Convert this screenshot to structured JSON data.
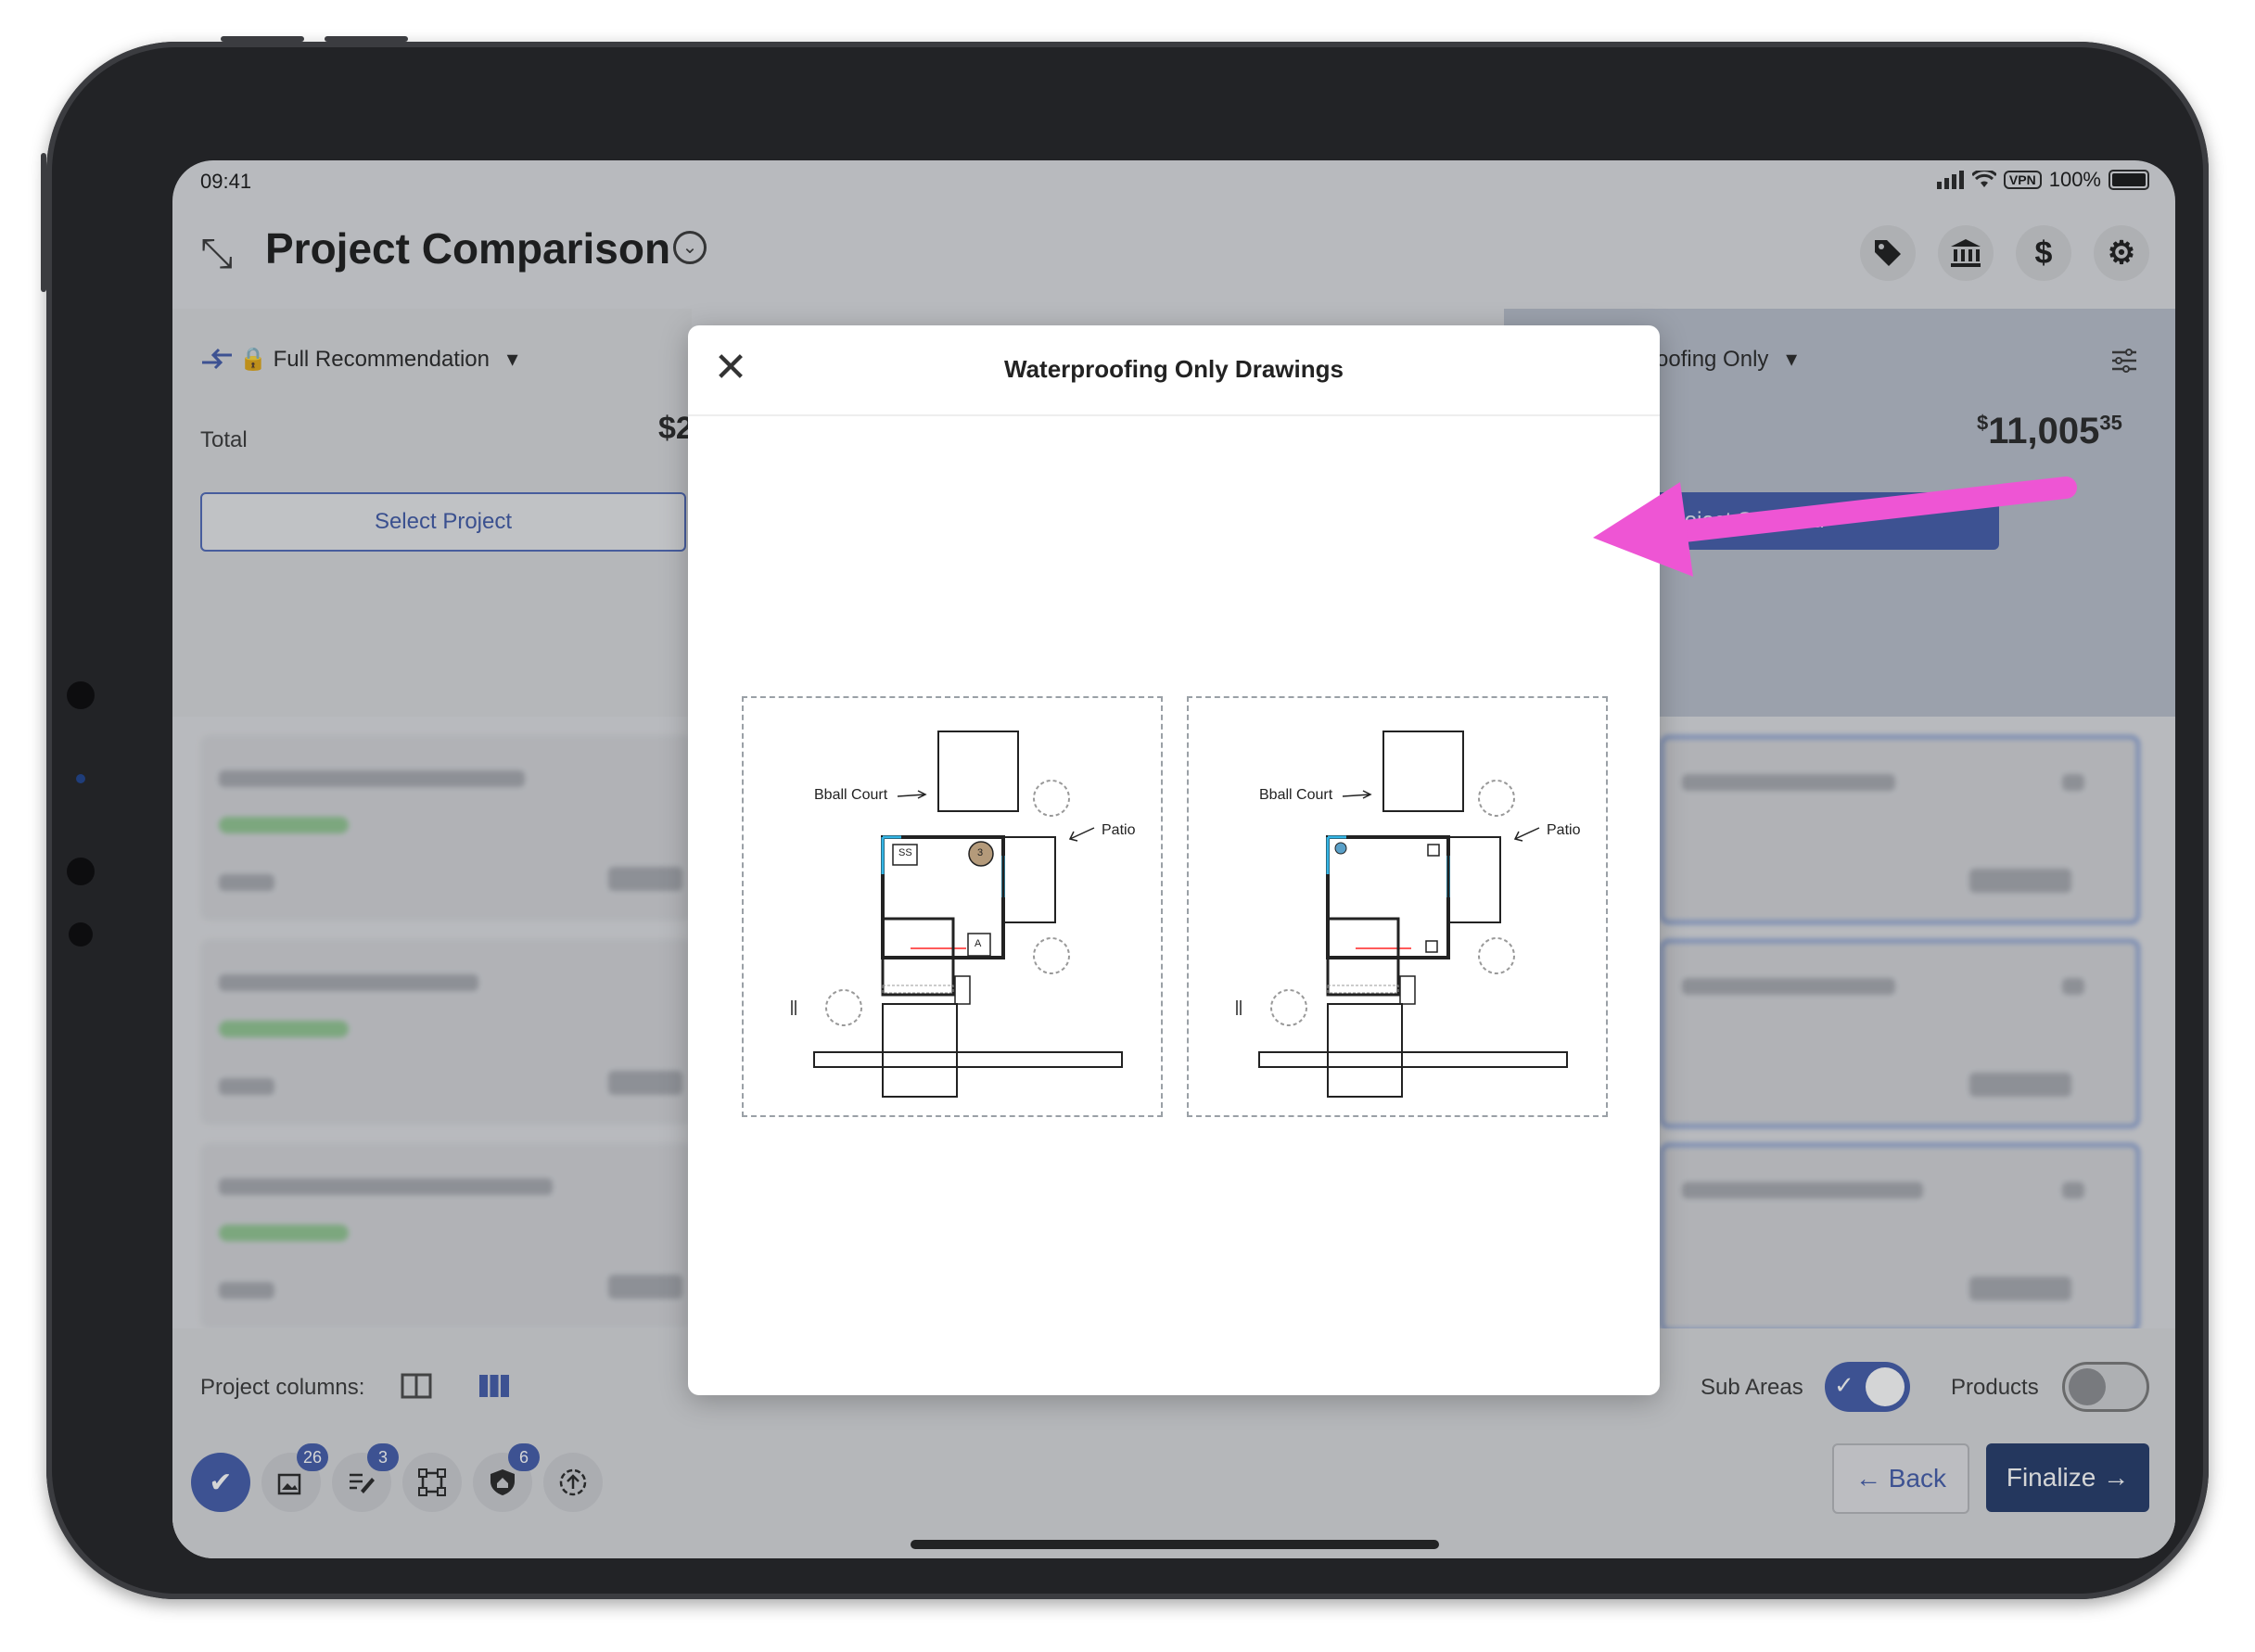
{
  "status": {
    "time": "09:41",
    "vpn": "VPN",
    "battery": "100%"
  },
  "header": {
    "title": "Project Comparison",
    "expand_icon": "expand-arrows-icon",
    "chevron_icon": "chevron-down-circle-icon"
  },
  "header_icons": [
    "tag-icon",
    "bank-icon",
    "dollar-icon",
    "gear-icon"
  ],
  "left_column": {
    "option_label": "Full Recommendation",
    "total_label": "Total",
    "total_partial": "$2",
    "select_label": "Select Project"
  },
  "right_column": {
    "option_label": "oofing Only",
    "total_main": "11,005",
    "total_cents": "35",
    "total_currency": "$",
    "selected_label": "Project Selected"
  },
  "modal": {
    "title": "Waterproofing Only Drawings",
    "drawings": [
      {
        "label_court": "Bball Court",
        "label_patio": "Patio",
        "marker_ss": "SS",
        "marker_3": "3",
        "marker_a": "A"
      },
      {
        "label_court": "Bball Court",
        "label_patio": "Patio"
      }
    ]
  },
  "bottom": {
    "project_columns_label": "Project columns:",
    "sub_areas_label": "Sub Areas",
    "products_label": "Products",
    "sub_areas_on": true,
    "products_on": false,
    "back_label": "Back",
    "finalize_label": "Finalize",
    "toolbar_badges": {
      "photos": "26",
      "notes": "3",
      "shield": "6"
    }
  },
  "colors": {
    "accent": "#3e58a8",
    "navy": "#1e3566",
    "annotation": "#ee55d4"
  }
}
